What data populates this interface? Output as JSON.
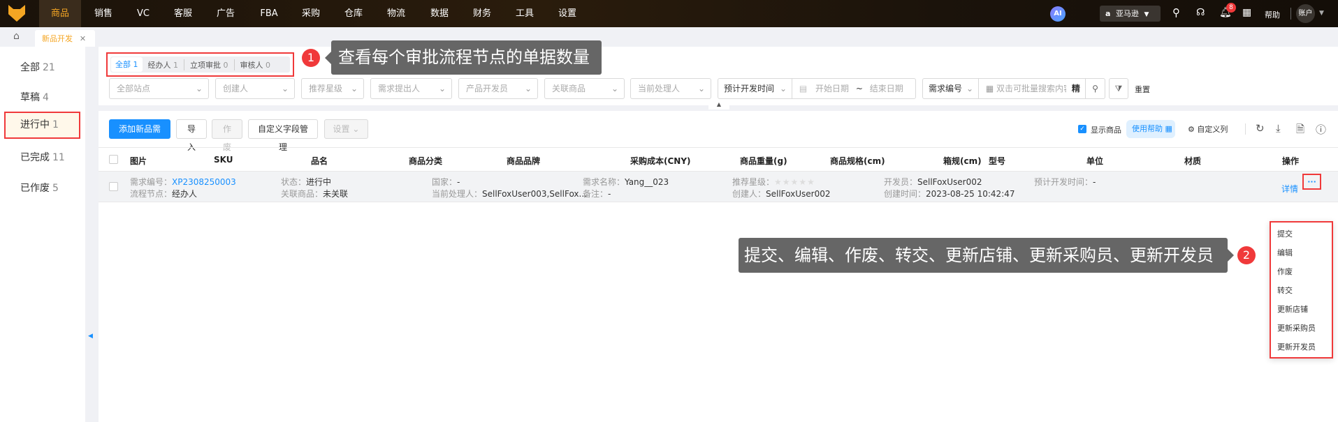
{
  "nav": {
    "items": [
      "商品",
      "销售",
      "VC",
      "客服",
      "广告",
      "FBA",
      "采购",
      "仓库",
      "物流",
      "数据",
      "财务",
      "工具",
      "设置"
    ],
    "active": "商品",
    "ai_label": "AI",
    "marketplace": "亚马逊",
    "notification_count": "8",
    "help": "帮助",
    "account": "账户"
  },
  "tabs": {
    "active_tab": "新品开发"
  },
  "sidebar": {
    "items": [
      {
        "label": "全部",
        "count": "21"
      },
      {
        "label": "草稿",
        "count": "4"
      },
      {
        "label": "进行中",
        "count": "1"
      },
      {
        "label": "已完成",
        "count": "11"
      },
      {
        "label": "已作废",
        "count": "5"
      }
    ],
    "active": "进行中"
  },
  "status_tabs": [
    {
      "label": "全部",
      "count": "1"
    },
    {
      "label": "经办人",
      "count": "1"
    },
    {
      "label": "立项审批",
      "count": "0"
    },
    {
      "label": "审核人",
      "count": "0"
    }
  ],
  "filters": {
    "site": "全部站点",
    "creator": "创建人",
    "rating": "推荐星级",
    "requester": "需求提出人",
    "developer": "产品开发员",
    "linked": "关联商品",
    "handler": "当前处理人",
    "date_type": "预计开发时间",
    "start_date": "开始日期",
    "date_sep": "~",
    "end_date": "结束日期",
    "search_type": "需求编号",
    "search_placeholder": "双击可批量搜索内容",
    "exact": "精",
    "reset": "重置"
  },
  "toolbar": {
    "add": "添加新品需求",
    "import": "导入",
    "void": "作废",
    "custom_fields": "自定义字段管理",
    "settings": "设置",
    "show_products": "显示商品",
    "help": "使用帮助",
    "custom_columns": "自定义列"
  },
  "table": {
    "headers": [
      "图片",
      "SKU",
      "品名",
      "商品分类",
      "商品品牌",
      "采购成本(CNY)",
      "商品重量(g)",
      "商品规格(cm)",
      "箱规(cm)",
      "型号",
      "单位",
      "材质",
      "操作"
    ],
    "row": {
      "req_no_label": "需求编号：",
      "req_no": "XP2308250003",
      "node_label": "流程节点：",
      "node": "经办人",
      "status_label": "状态：",
      "status": "进行中",
      "linked_label": "关联商品：",
      "linked": "未关联",
      "country_label": "国家：",
      "country": "-",
      "handler_label": "当前处理人：",
      "handler": "SellFoxUser003,SellFox...",
      "name_label": "需求名称：",
      "name": "Yang__023",
      "remark_label": "备注：",
      "remark": "-",
      "rating_label": "推荐星级：",
      "rating": 0,
      "rating_max": 5,
      "creator_label": "创建人：",
      "creator": "SellFoxUser002",
      "developer_label": "开发员：",
      "developer": "SellFoxUser002",
      "created_label": "创建时间：",
      "created": "2023-08-25 10:42:47",
      "plan_label": "预计开发时间：",
      "plan": "-",
      "detail": "详情",
      "more": "···"
    }
  },
  "dropdown": [
    "提交",
    "编辑",
    "作废",
    "转交",
    "更新店铺",
    "更新采购员",
    "更新开发员"
  ],
  "annotations": [
    {
      "num": "1",
      "text": "查看每个审批流程节点的单据数量"
    },
    {
      "num": "2",
      "text": "提交、编辑、作废、转交、更新店铺、更新采购员、更新开发员"
    }
  ],
  "colors": {
    "accent": "#1890ff",
    "brand": "#f5a623",
    "annotation": "#f0393a"
  }
}
